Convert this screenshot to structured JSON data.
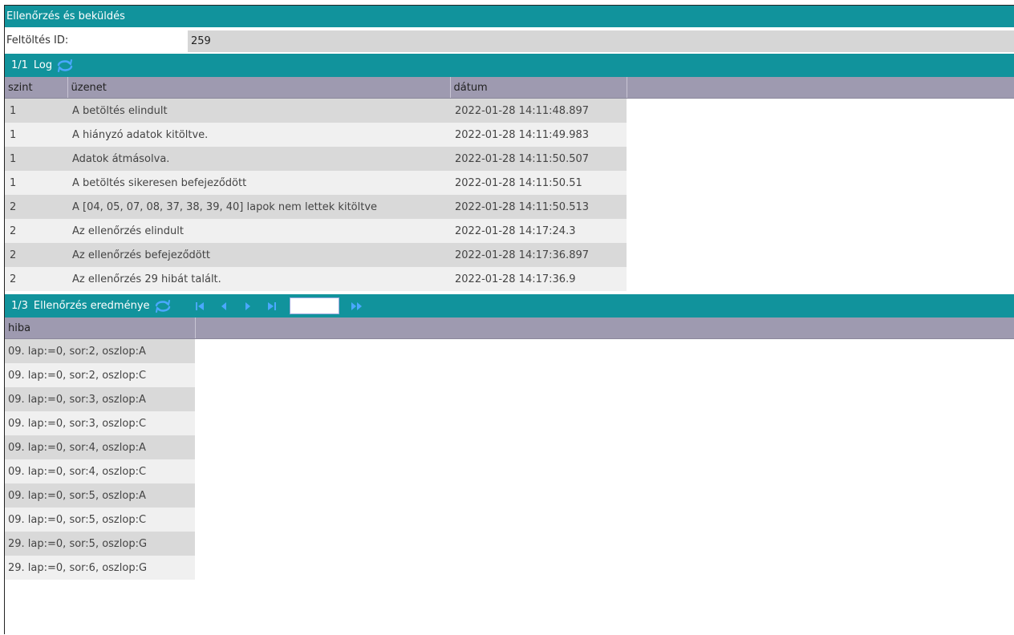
{
  "window": {
    "title": "Ellenőrzés és beküldés"
  },
  "upload": {
    "id_label": "Feltöltés ID:",
    "id_value": "259"
  },
  "log": {
    "pager": "1/1",
    "title": "Log",
    "columns": [
      "szint",
      "üzenet",
      "dátum"
    ],
    "rows": [
      [
        "1",
        "A betöltés elindult",
        "2022-01-28 14:11:48.897"
      ],
      [
        "1",
        "A hiányzó adatok kitöltve.",
        "2022-01-28 14:11:49.983"
      ],
      [
        "1",
        "Adatok átmásolva.",
        "2022-01-28 14:11:50.507"
      ],
      [
        "1",
        "A betöltés sikeresen befejeződött",
        "2022-01-28 14:11:50.51"
      ],
      [
        "2",
        "A [04, 05, 07, 08, 37, 38, 39, 40] lapok nem lettek kitöltve",
        "2022-01-28 14:11:50.513"
      ],
      [
        "2",
        "Az ellenőrzés elindult",
        "2022-01-28 14:17:24.3"
      ],
      [
        "2",
        "Az ellenőrzés befejeződött",
        "2022-01-28 14:17:36.897"
      ],
      [
        "2",
        "Az ellenőrzés 29 hibát talált.",
        "2022-01-28 14:17:36.9"
      ]
    ]
  },
  "result": {
    "pager": "1/3",
    "title": "Ellenőrzés eredménye",
    "page_input_value": "",
    "columns": [
      "hiba"
    ],
    "rows": [
      [
        "09. lap:=0, sor:2, oszlop:A"
      ],
      [
        "09. lap:=0, sor:2, oszlop:C"
      ],
      [
        "09. lap:=0, sor:3, oszlop:A"
      ],
      [
        "09. lap:=0, sor:3, oszlop:C"
      ],
      [
        "09. lap:=0, sor:4, oszlop:A"
      ],
      [
        "09. lap:=0, sor:4, oszlop:C"
      ],
      [
        "09. lap:=0, sor:5, oszlop:A"
      ],
      [
        "09. lap:=0, sor:5, oszlop:C"
      ],
      [
        "29. lap:=0, sor:5, oszlop:G"
      ],
      [
        "29. lap:=0, sor:6, oszlop:G"
      ]
    ]
  },
  "colors": {
    "accent": "#11939c",
    "header": "#9e9ab0",
    "icon": "#4aa8ff"
  },
  "icons": [
    "refresh-icon",
    "first-page-icon",
    "prev-page-icon",
    "next-page-icon",
    "last-page-icon",
    "go-icon"
  ]
}
